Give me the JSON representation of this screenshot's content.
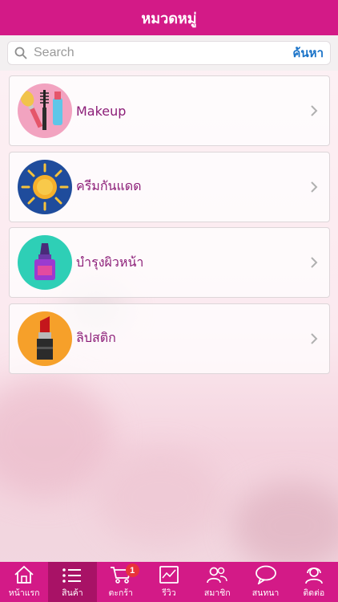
{
  "header": {
    "title": "หมวดหมู่"
  },
  "search": {
    "placeholder": "Search",
    "button_label": "ค้นหา"
  },
  "categories": [
    {
      "label": "Makeup",
      "icon": "makeup-brushes-icon",
      "icon_bg": "#f2a3c0"
    },
    {
      "label": "ครีมกันแดด",
      "icon": "sun-icon",
      "icon_bg": "#1f4c9c"
    },
    {
      "label": "บำรุงผิวหน้า",
      "icon": "serum-bottle-icon",
      "icon_bg": "#2ecfb6"
    },
    {
      "label": "ลิปสติก",
      "icon": "lipstick-icon",
      "icon_bg": "#f6a02a"
    }
  ],
  "tabbar": {
    "items": [
      {
        "label": "หน้าแรก",
        "icon": "home-icon"
      },
      {
        "label": "สินค้า",
        "icon": "list-icon",
        "active": true
      },
      {
        "label": "ตะกร้า",
        "icon": "cart-icon",
        "badge": "1"
      },
      {
        "label": "รีวิว",
        "icon": "review-icon"
      },
      {
        "label": "สมาชิก",
        "icon": "members-icon"
      },
      {
        "label": "สนทนา",
        "icon": "chat-icon"
      },
      {
        "label": "ติดต่อ",
        "icon": "contact-icon"
      }
    ]
  },
  "colors": {
    "accent": "#d31a87",
    "active_tab": "#a81266",
    "label": "#8c1e78",
    "search_button": "#1a73c8",
    "badge": "#e8333a"
  }
}
